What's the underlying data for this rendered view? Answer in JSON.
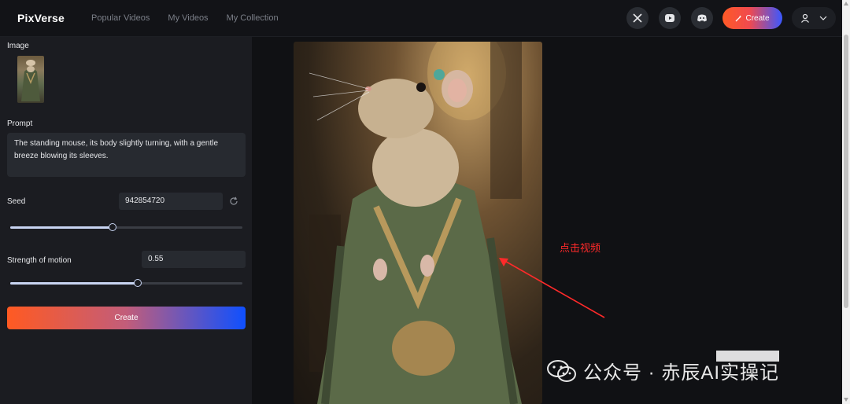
{
  "header": {
    "logo": "PixVerse",
    "nav": [
      "Popular Videos",
      "My Videos",
      "My Collection"
    ],
    "create_label": "Create"
  },
  "panel": {
    "image_label": "Image",
    "prompt_label": "Prompt",
    "prompt_text": "The standing mouse, its body slightly turning, with a gentle breeze blowing its sleeves.",
    "seed_label": "Seed",
    "seed_value": "942854720",
    "seed_slider_fraction": 0.44,
    "motion_label": "Strength of motion",
    "motion_value": "0.55",
    "motion_slider_fraction": 0.55,
    "create_label": "Create"
  },
  "main": {
    "annotation": "点击视频",
    "watermark": "公众号 · 赤辰AI实操记"
  },
  "colors": {
    "accent_red": "#ff2a2a",
    "slider": "#c8d4f2",
    "gradient_start": "#ff5a22",
    "gradient_end": "#0f50ff"
  }
}
